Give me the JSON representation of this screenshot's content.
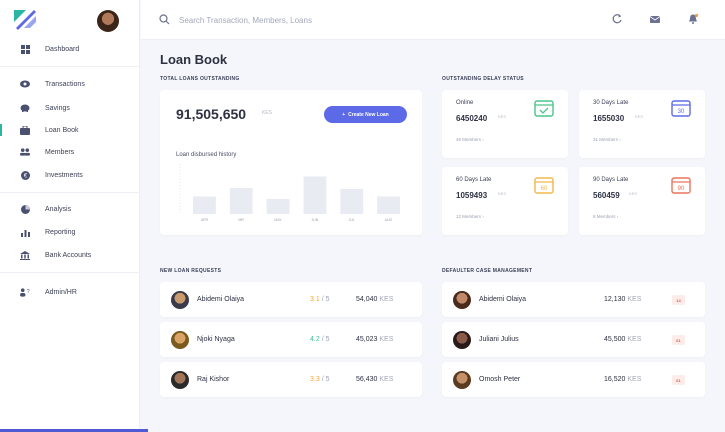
{
  "sidebar": {
    "items": [
      {
        "label": "Dashboard",
        "icon": "grid-icon"
      },
      {
        "label": "Transactions",
        "icon": "eye-icon"
      },
      {
        "label": "Savings",
        "icon": "piggy-icon"
      },
      {
        "label": "Loan Book",
        "icon": "briefcase-icon",
        "active": true
      },
      {
        "label": "Members",
        "icon": "users-icon"
      },
      {
        "label": "Investments",
        "icon": "coin-icon"
      },
      {
        "label": "Analysis",
        "icon": "pie-icon"
      },
      {
        "label": "Reporting",
        "icon": "bar-chart-icon"
      },
      {
        "label": "Bank Accounts",
        "icon": "bank-icon"
      },
      {
        "label": "Admin/HR",
        "icon": "admin-icon"
      }
    ]
  },
  "topbar": {
    "search_placeholder": "Search Transaction, Members, Loans"
  },
  "page": {
    "title": "Loan Book",
    "total_loans_label": "TOTAL LOANS OUTSTANDING",
    "delay_status_label": "OUTSTANDING DELAY STATUS",
    "new_requests_label": "NEW LOAN REQUESTS",
    "defaulter_label": "DEFAULTER CASE MANAGEMENT"
  },
  "total": {
    "amount": "91,505,650",
    "currency": "KES",
    "create_button": "Create New Loan",
    "chart_title": "Loan disbursed history"
  },
  "chart_data": {
    "type": "bar",
    "categories": [
      "APR",
      "MR",
      "MAY",
      "JUN",
      "JUL",
      "AUG"
    ],
    "values": [
      35,
      52,
      30,
      75,
      50,
      35
    ],
    "ylim": [
      0,
      100
    ],
    "xlabel": "",
    "ylabel": "",
    "title": "Loan disbursed history",
    "color": "#e9ebf3"
  },
  "delay": [
    {
      "title": "Online",
      "value": "6450240",
      "currency": "KES",
      "link": "45 Members",
      "cal_color": "#4cc38a",
      "cal_text": "✓"
    },
    {
      "title": "30 Days Late",
      "value": "1655030",
      "currency": "KES",
      "link": "31 Members",
      "cal_color": "#5d6ae8",
      "cal_text": "30"
    },
    {
      "title": "60 Days Late",
      "value": "1059493",
      "currency": "KES",
      "link": "12 Members",
      "cal_color": "#f2b84b",
      "cal_text": "60"
    },
    {
      "title": "90 Days Late",
      "value": "560459",
      "currency": "KES",
      "link": "8 Members",
      "cal_color": "#e9765a",
      "cal_text": "90"
    }
  ],
  "requests": [
    {
      "name": "Abidemi Olaiya",
      "score": "3.1",
      "max": "/ 5",
      "score_color": "#f2a93b",
      "amount": "54,040",
      "currency": "KES"
    },
    {
      "name": "Njoki Nyaga",
      "score": "4.2",
      "max": "/ 5",
      "score_color": "#3fbf8f",
      "amount": "45,023",
      "currency": "KES"
    },
    {
      "name": "Raj Kishor",
      "score": "3.3",
      "max": "/ 5",
      "score_color": "#f2a93b",
      "amount": "56,430",
      "currency": "KES"
    }
  ],
  "defaulters": [
    {
      "name": "Abidemi Olaiya",
      "amount": "12,130",
      "currency": "KES",
      "days": "14"
    },
    {
      "name": "Juliani Julius",
      "amount": "45,500",
      "currency": "KES",
      "days": "61"
    },
    {
      "name": "Omosh Peter",
      "amount": "16,520",
      "currency": "KES",
      "days": "61"
    }
  ]
}
